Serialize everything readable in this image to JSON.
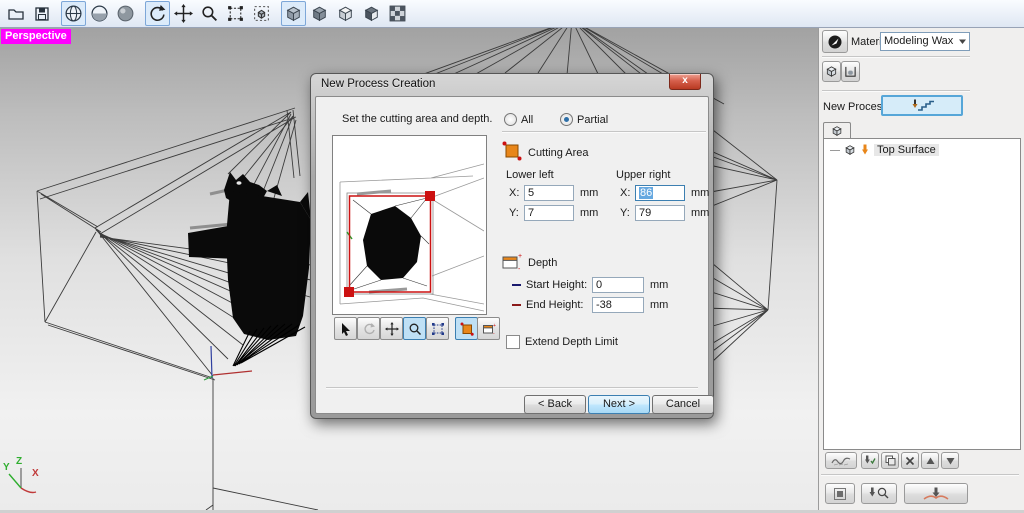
{
  "toolbar": {
    "icons": [
      "open-file",
      "save",
      "wireframe-view",
      "hidden-line-view",
      "shaded-view",
      "rotate-view",
      "pan-view",
      "zoom-view",
      "zoom-extents",
      "rotate-object",
      "iso-cube-view",
      "top-cube-view",
      "front-cube-view",
      "corner-cube-view",
      "pattern-view"
    ]
  },
  "viewport": {
    "perspective_label": "Perspective",
    "axis_x": "X",
    "axis_y": "Y",
    "axis_z": "Z"
  },
  "dialog": {
    "title": "New Process Creation",
    "close_glyph": "x",
    "instruction": "Set the cutting area and depth.",
    "radios": {
      "all": "All",
      "partial": "Partial",
      "selected": "Partial"
    },
    "preview_tools": [
      "select",
      "rotate",
      "pan",
      "zoom",
      "fit",
      "cutting-area",
      "depth"
    ],
    "cutting_area": {
      "label": "Cutting Area",
      "lower_left_label": "Lower left",
      "upper_right_label": "Upper right",
      "x_label": "X:",
      "y_label": "Y:",
      "unit": "mm",
      "lower_left_x": "5",
      "lower_left_y": "7",
      "upper_right_x": "86",
      "upper_right_y": "79"
    },
    "depth": {
      "label": "Depth",
      "start_label": "Start Height:",
      "end_label": "End Height:",
      "start_value": "0",
      "end_value": "-38",
      "unit": "mm"
    },
    "extend_label": "Extend Depth Limit",
    "buttons": {
      "back": "< Back",
      "next": "Next >",
      "cancel": "Cancel"
    }
  },
  "right_panel": {
    "material_label": "Material",
    "material_value": "Modeling Wax",
    "new_process_label": "New Process",
    "tree": {
      "items": [
        {
          "label": "Top Surface"
        }
      ]
    },
    "tool_buttons": [
      "toolpath",
      "tool-settings",
      "duplicate",
      "delete",
      "move-up",
      "move-down",
      "preview",
      "tool-inspect",
      "cut"
    ]
  },
  "colors": {
    "perspective_bg": "#ff00ff",
    "selection_blue": "#66a8e0",
    "highlight_button": "#d6ecf9",
    "red_handle": "#cc1111",
    "orange_icon": "#e8861a"
  }
}
